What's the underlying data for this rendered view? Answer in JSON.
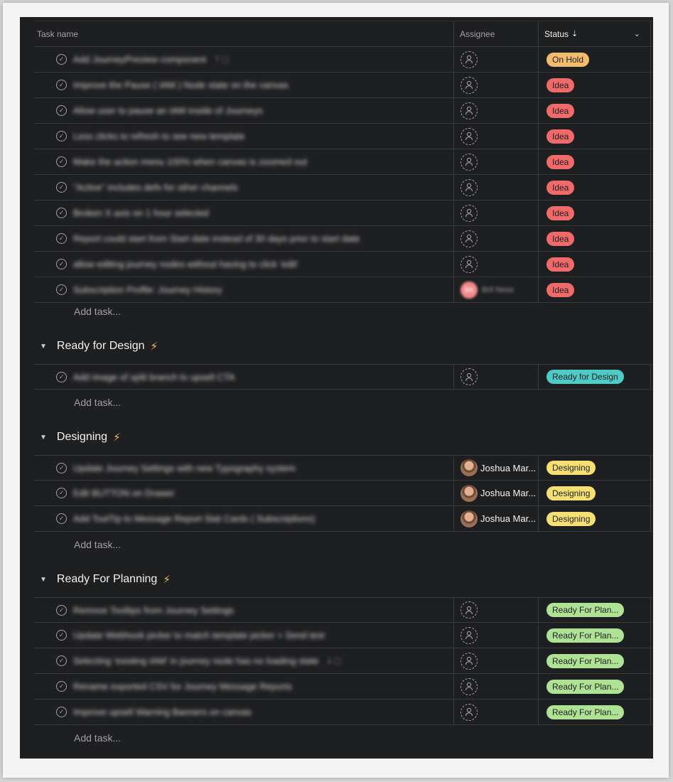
{
  "header": {
    "task_name": "Task name",
    "assignee": "Assignee",
    "status": "Status",
    "sort_icon": "sort-descending-icon",
    "chevron_icon": "chevron-down-icon"
  },
  "colors": {
    "on_hold": "#f1bd6c",
    "idea": "#f06a6a",
    "ready_for_design": "#4ecbc4",
    "designing": "#f8df72",
    "ready_for_planning": "#aee396"
  },
  "add_task_label": "Add task...",
  "groups": {
    "top": {
      "rows": [
        {
          "name": "Add JourneyPreview component",
          "meta": "7 ▢",
          "status": "On Hold"
        },
        {
          "name": "Improve the Pause ( IAM ) Node state on the canvas",
          "status": "Idea"
        },
        {
          "name": "Allow user to pause an IAM inside of Journeys",
          "status": "Idea"
        },
        {
          "name": "Less clicks to refresh to see new template",
          "status": "Idea"
        },
        {
          "name": "Make the action menu 100% when canvas is zoomed out",
          "status": "Idea"
        },
        {
          "name": "\"Active\" includes defs for other channels",
          "status": "Idea"
        },
        {
          "name": "Broken X axis on 1 hour selected",
          "status": "Idea"
        },
        {
          "name": "Report could start from Start date instead of 30 days prior to start date",
          "status": "Idea"
        },
        {
          "name": "allow editing journey nodes without having to click 'edit'",
          "status": "Idea"
        },
        {
          "name": "Subscription Profile: Journey History",
          "assignee": "Brit Ness",
          "initials": "BN",
          "status": "Idea"
        }
      ]
    },
    "ready_for_design": {
      "title": "Ready for Design",
      "rows": [
        {
          "name": "Add image of split branch to upsell CTA",
          "status": "Ready for Design"
        }
      ]
    },
    "designing": {
      "title": "Designing",
      "rows": [
        {
          "name": "Update Journey Settings with new Typography system",
          "assignee": "Joshua Mar...",
          "status": "Designing"
        },
        {
          "name": "Edit BUTTON on Drawer",
          "assignee": "Joshua Mar...",
          "status": "Designing"
        },
        {
          "name": "Add ToolTip to Message Report Stat Cards ( Subscriptions)",
          "assignee": "Joshua Mar...",
          "status": "Designing"
        }
      ]
    },
    "ready_for_planning": {
      "title": "Ready For Planning",
      "rows": [
        {
          "name": "Remove Tooltips from Journey Settings",
          "status": "Ready For Plan..."
        },
        {
          "name": "Update Webhook picker to match template picker + Send test",
          "status": "Ready For Plan..."
        },
        {
          "name": "Selecting 'existing IAM' in journey node has no loading state",
          "meta": "1 ▢",
          "status": "Ready For Plan..."
        },
        {
          "name": "Rename exported CSV for Journey Message Reports",
          "status": "Ready For Plan..."
        },
        {
          "name": "Improve upsell Warning Banners on canvas",
          "status": "Ready For Plan..."
        }
      ]
    }
  }
}
